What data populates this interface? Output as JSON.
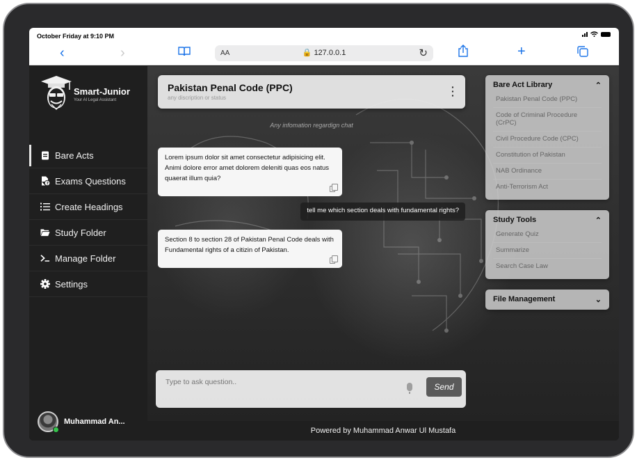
{
  "status_bar": {
    "time": "October Friday at 9:10 PM"
  },
  "browser": {
    "url": "127.0.0.1",
    "aa_label": "AA",
    "icons": [
      "back-icon",
      "forward-icon",
      "bookmarks-icon",
      "reload-icon",
      "share-icon",
      "new-tab-icon",
      "tabs-icon"
    ]
  },
  "brand": {
    "name": "Smart-Junior",
    "tagline": "Your AI Legal Assistant"
  },
  "nav": {
    "items": [
      {
        "label": "Bare Acts",
        "icon": "book-icon",
        "active": true
      },
      {
        "label": "Exams Questions",
        "icon": "file-question-icon",
        "active": false
      },
      {
        "label": "Create Headings",
        "icon": "list-icon",
        "active": false
      },
      {
        "label": "Study Folder",
        "icon": "folder-icon",
        "active": false
      },
      {
        "label": "Manage Folder",
        "icon": "terminal-icon",
        "active": false
      },
      {
        "label": "Settings",
        "icon": "gear-icon",
        "active": false
      }
    ]
  },
  "user": {
    "name": "Muhammad An..."
  },
  "chat": {
    "title": "Pakistan Penal Code (PPC)",
    "subtitle": "any discription or status",
    "info": "Any infomation regardign chat",
    "messages": [
      {
        "role": "bot",
        "text": "Lorem ipsum dolor sit amet consectetur adipisicing elit. Animi dolore error amet dolorem deleniti quas eos natus quaerat illum quia?"
      },
      {
        "role": "user",
        "text": "tell me which section deals with fundamental rights?"
      },
      {
        "role": "bot",
        "text": "Section 8 to section 28 of Pakistan Penal Code deals with Fundamental rights of a citizin of Pakistan."
      }
    ],
    "composer": {
      "placeholder": "Type to ask question..",
      "send_label": "Send"
    }
  },
  "library": {
    "bare_acts": {
      "title": "Bare Act Library",
      "items": [
        "Pakistan Penal Code (PPC)",
        "Code of Criminal Procedure (CrPC)",
        "Civil Procedure Code (CPC)",
        "Constitution of Pakistan",
        "NAB Ordinance",
        "Anti-Terrorism Act"
      ]
    },
    "study_tools": {
      "title": "Study Tools",
      "items": [
        "Generate Quiz",
        "Summarize",
        "Search Case Law"
      ]
    },
    "file_management": {
      "title": "File Management"
    }
  },
  "footer": {
    "text": "Powered by Muhammad Anwar Ul Mustafa"
  }
}
